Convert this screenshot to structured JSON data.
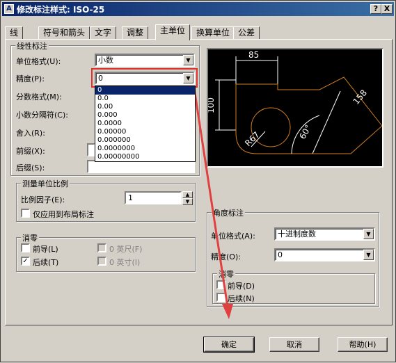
{
  "window": {
    "title": "修改标注样式: ISO-25",
    "help_btn": "?",
    "close_btn": "X"
  },
  "tabs": [
    "线",
    "符号和箭头",
    "文字",
    "调整",
    "主单位",
    "换算单位",
    "公差"
  ],
  "linear": {
    "group_title": "线性标注",
    "unit_format_label": "单位格式(U):",
    "unit_format_value": "小数",
    "precision_label": "精度(P):",
    "precision_value": "0",
    "fraction_label": "分数格式(M):",
    "decimal_sep_label": "小数分隔符(C):",
    "roundoff_label": "舍入(R):",
    "prefix_label": "前缀(X):",
    "suffix_label": "后缀(S):",
    "precision_options": [
      "0",
      "0.0",
      "0.00",
      "0.000",
      "0.0000",
      "0.00000",
      "0.000000",
      "0.0000000",
      "0.00000000"
    ]
  },
  "scale": {
    "group_title": "测量单位比例",
    "factor_label": "比例因子(E):",
    "factor_value": "1",
    "layout_only_label": "仅应用到布局标注"
  },
  "zero": {
    "group_title": "消零",
    "leading_label": "前导(L)",
    "trailing_label": "后续(T)",
    "feet_label": "0 英尺(F)",
    "inches_label": "0 英寸(I)"
  },
  "angular": {
    "group_title": "角度标注",
    "unit_format_label": "单位格式(A):",
    "unit_format_value": "十进制度数",
    "precision_label": "精度(O):",
    "precision_value": "0",
    "zero_title": "消零",
    "leading_label": "前导(D)",
    "trailing_label": "后续(N)"
  },
  "preview": {
    "dim_85": "85",
    "dim_100": "100",
    "dim_158": "158",
    "dim_r67": "R67",
    "dim_60": "60°"
  },
  "buttons": {
    "ok": "确定",
    "cancel": "取消",
    "help": "帮助(H)"
  },
  "accent": {
    "highlight_box": "#e03030",
    "arrow": "#e04040",
    "preview_lines": "#ffffff",
    "preview_arc": "#d08020"
  }
}
